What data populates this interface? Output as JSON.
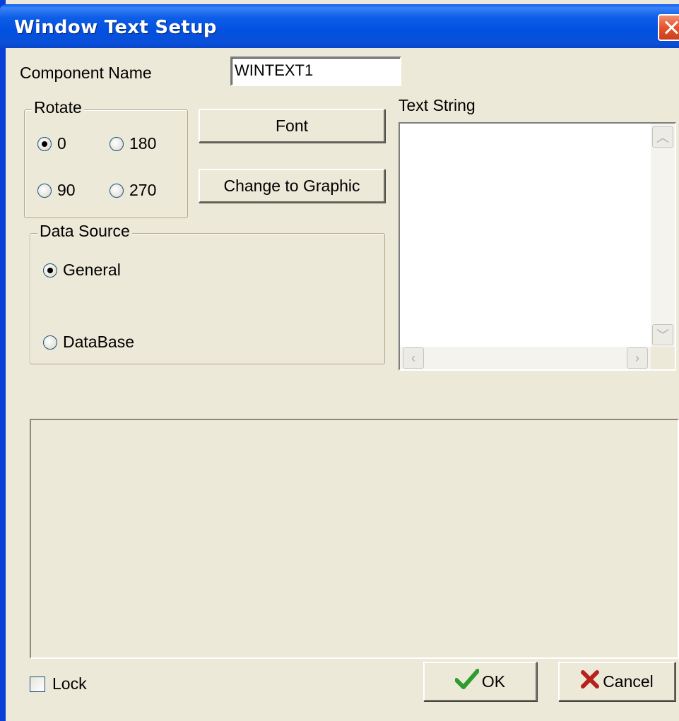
{
  "window": {
    "title": "Window Text  Setup"
  },
  "component_name": {
    "label": "Component Name",
    "value": "WINTEXT1"
  },
  "rotate": {
    "title": "Rotate",
    "options": [
      "0",
      "180",
      "90",
      "270"
    ],
    "selected": "0"
  },
  "buttons": {
    "font": "Font",
    "change_to_graphic": "Change to Graphic",
    "ok": "OK",
    "cancel": "Cancel"
  },
  "text_string": {
    "label": "Text String",
    "value": ""
  },
  "data_source": {
    "title": "Data Source",
    "options": [
      "General",
      "DataBase"
    ],
    "selected": "General"
  },
  "lock": {
    "label": "Lock",
    "checked": false
  },
  "colors": {
    "titlebar": "#0a5bf0",
    "ok_check": "#2e9c2e",
    "cancel_x": "#b5231b"
  }
}
